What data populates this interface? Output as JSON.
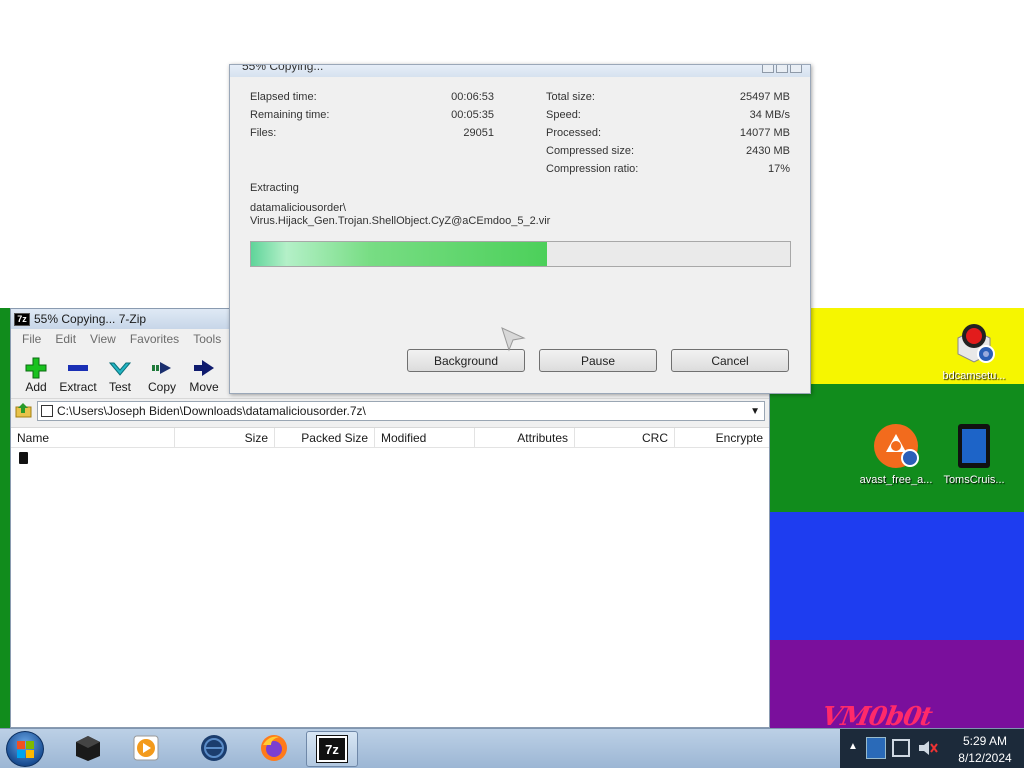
{
  "colors": {
    "wallpaper_yellow": "#f6f600",
    "wallpaper_green": "#118c1c",
    "wallpaper_blue": "#1e3df0",
    "wallpaper_purple": "#7a0f9c",
    "progress_green": "#4cd05a"
  },
  "desktop": {
    "brand_text": "VM0b0t",
    "icons": [
      {
        "label": "bdcamsetu...",
        "icon": "record-camera-icon"
      },
      {
        "label": "avast_free_a...",
        "icon": "avast-icon"
      },
      {
        "label": "TomsCruis...",
        "icon": "tablet-icon"
      }
    ]
  },
  "zip_window": {
    "title": "55% Copying... 7-Zip",
    "app_icon_text": "7z",
    "menu": [
      "File",
      "Edit",
      "View",
      "Favorites",
      "Tools"
    ],
    "toolbar": [
      {
        "label": "Add",
        "icon": "plus-icon"
      },
      {
        "label": "Extract",
        "icon": "minus-icon"
      },
      {
        "label": "Test",
        "icon": "check-icon"
      },
      {
        "label": "Copy",
        "icon": "copy-arrow-icon"
      },
      {
        "label": "Move",
        "icon": "move-arrow-icon"
      }
    ],
    "address_path": "C:\\Users\\Joseph Biden\\Downloads\\datamaliciousorder.7z\\",
    "columns": [
      "Name",
      "Size",
      "Packed Size",
      "Modified",
      "Attributes",
      "CRC",
      "Encrypte"
    ]
  },
  "dialog": {
    "title": "55% Copying...",
    "left_stats": [
      {
        "label": "Elapsed time:",
        "value": "00:06:53"
      },
      {
        "label": "Remaining time:",
        "value": "00:05:35"
      },
      {
        "label": "Files:",
        "value": "29051"
      }
    ],
    "right_stats": [
      {
        "label": "Total size:",
        "value": "25497 MB"
      },
      {
        "label": "Speed:",
        "value": "34 MB/s"
      },
      {
        "label": "Processed:",
        "value": "14077 MB"
      },
      {
        "label": "Compressed size:",
        "value": "2430 MB"
      },
      {
        "label": "Compression ratio:",
        "value": "17%"
      }
    ],
    "status_label": "Extracting",
    "current_path_line1": "datamaliciousorder\\",
    "current_path_line2": "Virus.Hijack_Gen.Trojan.ShellObject.CyZ@aCEmdoo_5_2.vir",
    "progress_fraction": 0.55,
    "buttons": {
      "background": "Background",
      "pause": "Pause",
      "cancel": "Cancel"
    }
  },
  "taskbar": {
    "apps": [
      "file-explorer-icon",
      "media-player-icon",
      "app-globe-icon",
      "firefox-icon",
      "7zip-icon"
    ],
    "active_app_label": "7z",
    "time": "5:29 AM",
    "date": "8/12/2024"
  }
}
